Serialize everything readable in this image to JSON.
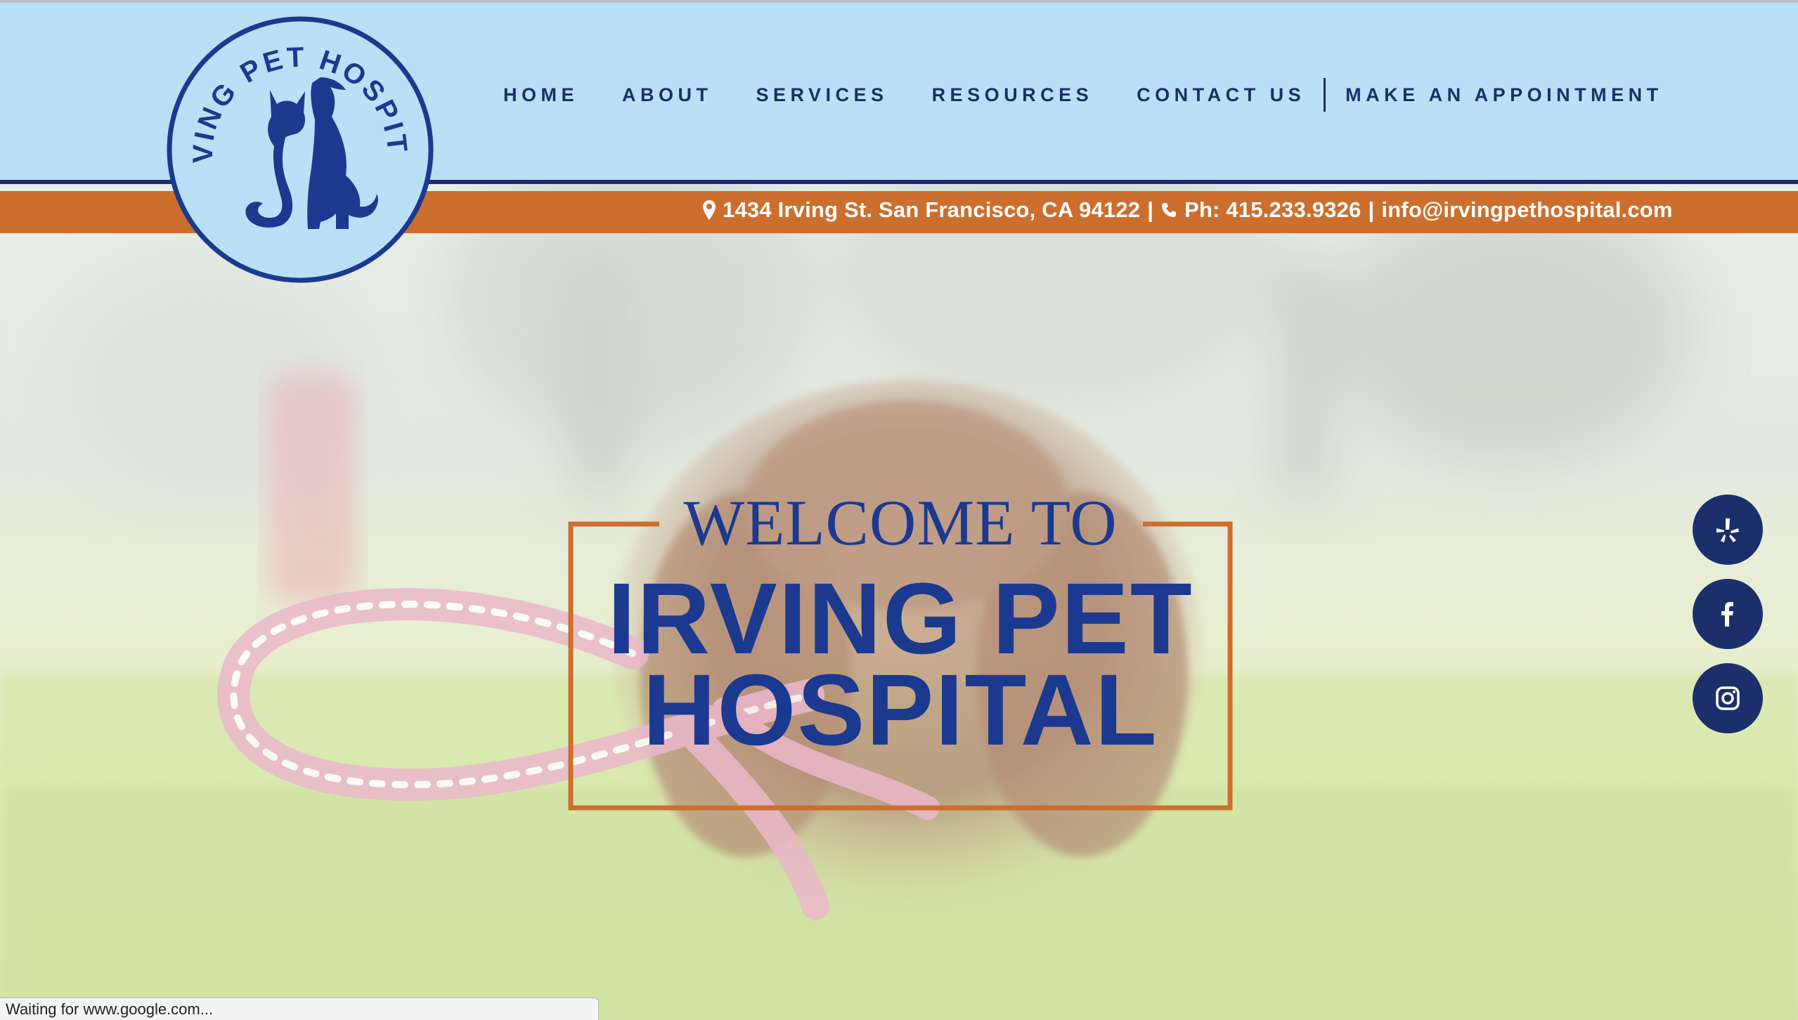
{
  "site": {
    "name": "IRVING PET HOSPITAL",
    "logo_text": "IRVING PET HOSPITAL"
  },
  "nav": {
    "items": [
      {
        "label": "HOME"
      },
      {
        "label": "ABOUT"
      },
      {
        "label": "SERVICES"
      },
      {
        "label": "RESOURCES"
      },
      {
        "label": "CONTACT US"
      }
    ],
    "cta": "MAKE AN APPOINTMENT"
  },
  "info_bar": {
    "address": "1434 Irving St. San Francisco, CA 94122",
    "sep": "|",
    "phone": "Ph: 415.233.9326",
    "email": "info@irvingpethospital.com",
    "address_icon": "map-marker-icon",
    "phone_icon": "phone-icon"
  },
  "hero": {
    "welcome": "WELCOME TO",
    "title_line1": "IRVING PET",
    "title_line2": "HOSPITAL"
  },
  "social": [
    {
      "name": "yelp",
      "icon": "yelp-icon"
    },
    {
      "name": "facebook",
      "icon": "facebook-icon"
    },
    {
      "name": "instagram",
      "icon": "instagram-icon"
    }
  ],
  "status_bar": {
    "text": "Waiting for www.google.com..."
  },
  "colors": {
    "header_bg": "#b9e0f7",
    "navy": "#1b2f6b",
    "orange": "#cc6f2e",
    "title_blue": "#1b3a8f"
  }
}
